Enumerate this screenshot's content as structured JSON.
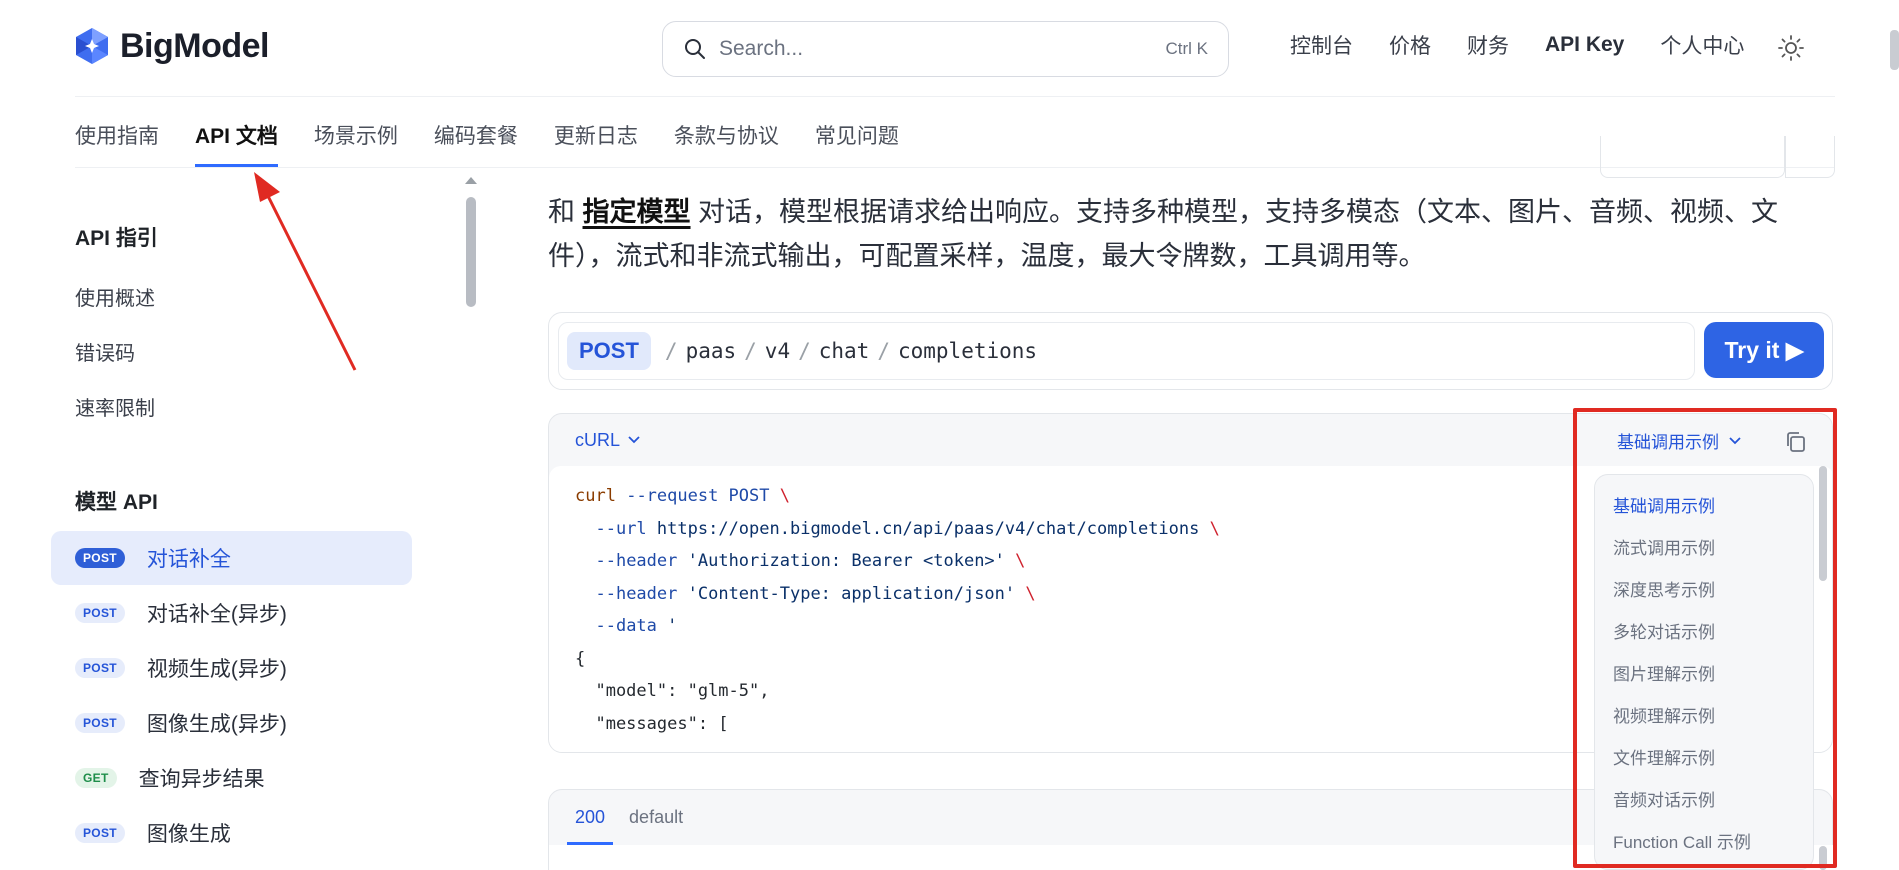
{
  "brand": {
    "name": "BigModel"
  },
  "search": {
    "placeholder": "Search...",
    "shortcut": "Ctrl K"
  },
  "topnav": [
    "控制台",
    "价格",
    "财务",
    "API Key",
    "个人中心"
  ],
  "subnav": [
    "使用指南",
    "API 文档",
    "场景示例",
    "编码套餐",
    "更新日志",
    "条款与协议",
    "常见问题"
  ],
  "sidebar": {
    "section1": {
      "heading": "API 指引",
      "links": [
        "使用概述",
        "错误码",
        "速率限制"
      ]
    },
    "section2": {
      "heading": "模型 API",
      "items": [
        {
          "method": "POST",
          "label": "对话补全"
        },
        {
          "method": "POST",
          "label": "对话补全(异步)"
        },
        {
          "method": "POST",
          "label": "视频生成(异步)"
        },
        {
          "method": "POST",
          "label": "图像生成(异步)"
        },
        {
          "method": "GET",
          "label": "查询异步结果"
        },
        {
          "method": "POST",
          "label": "图像生成"
        }
      ]
    }
  },
  "main": {
    "desc_prefix": "和 ",
    "desc_highlight": "指定模型",
    "desc_rest": " 对话，模型根据请求给出响应。支持多种模型，支持多模态（文本、图片、音频、视频、文件），流式和非流式输出，可配置采样，温度，最大令牌数，工具调用等。",
    "endpoint": {
      "method": "POST",
      "segments": [
        "paas",
        "v4",
        "chat",
        "completions"
      ],
      "try_label": "Try it ▶"
    },
    "code": {
      "language": "cURL",
      "lines": [
        "curl --request POST \\",
        "  --url https://open.bigmodel.cn/api/paas/v4/chat/completions \\",
        "  --header 'Authorization: Bearer <token>' \\",
        "  --header 'Content-Type: application/json' \\",
        "  --data '",
        "{",
        "  \"model\": \"glm-5\",",
        "  \"messages\": ["
      ]
    },
    "response_tabs": [
      "200",
      "default"
    ]
  },
  "example_dropdown": {
    "selected": "基础调用示例",
    "options": [
      "基础调用示例",
      "流式调用示例",
      "深度思考示例",
      "多轮对话示例",
      "图片理解示例",
      "视频理解示例",
      "文件理解示例",
      "音频对话示例",
      "Function Call 示例"
    ]
  },
  "colors": {
    "accent": "#2e64e4",
    "annotation": "#e02a22"
  }
}
